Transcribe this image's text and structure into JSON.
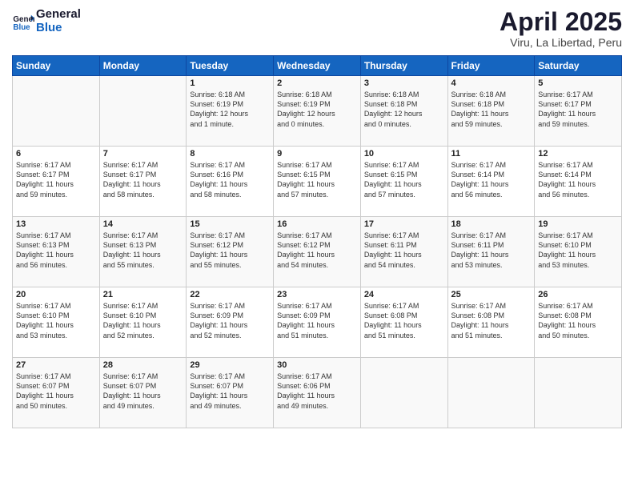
{
  "logo": {
    "line1": "General",
    "line2": "Blue"
  },
  "title": "April 2025",
  "location": "Viru, La Libertad, Peru",
  "weekdays": [
    "Sunday",
    "Monday",
    "Tuesday",
    "Wednesday",
    "Thursday",
    "Friday",
    "Saturday"
  ],
  "weeks": [
    [
      {
        "day": "",
        "info": ""
      },
      {
        "day": "",
        "info": ""
      },
      {
        "day": "1",
        "info": "Sunrise: 6:18 AM\nSunset: 6:19 PM\nDaylight: 12 hours\nand 1 minute."
      },
      {
        "day": "2",
        "info": "Sunrise: 6:18 AM\nSunset: 6:19 PM\nDaylight: 12 hours\nand 0 minutes."
      },
      {
        "day": "3",
        "info": "Sunrise: 6:18 AM\nSunset: 6:18 PM\nDaylight: 12 hours\nand 0 minutes."
      },
      {
        "day": "4",
        "info": "Sunrise: 6:18 AM\nSunset: 6:18 PM\nDaylight: 11 hours\nand 59 minutes."
      },
      {
        "day": "5",
        "info": "Sunrise: 6:17 AM\nSunset: 6:17 PM\nDaylight: 11 hours\nand 59 minutes."
      }
    ],
    [
      {
        "day": "6",
        "info": "Sunrise: 6:17 AM\nSunset: 6:17 PM\nDaylight: 11 hours\nand 59 minutes."
      },
      {
        "day": "7",
        "info": "Sunrise: 6:17 AM\nSunset: 6:17 PM\nDaylight: 11 hours\nand 58 minutes."
      },
      {
        "day": "8",
        "info": "Sunrise: 6:17 AM\nSunset: 6:16 PM\nDaylight: 11 hours\nand 58 minutes."
      },
      {
        "day": "9",
        "info": "Sunrise: 6:17 AM\nSunset: 6:15 PM\nDaylight: 11 hours\nand 57 minutes."
      },
      {
        "day": "10",
        "info": "Sunrise: 6:17 AM\nSunset: 6:15 PM\nDaylight: 11 hours\nand 57 minutes."
      },
      {
        "day": "11",
        "info": "Sunrise: 6:17 AM\nSunset: 6:14 PM\nDaylight: 11 hours\nand 56 minutes."
      },
      {
        "day": "12",
        "info": "Sunrise: 6:17 AM\nSunset: 6:14 PM\nDaylight: 11 hours\nand 56 minutes."
      }
    ],
    [
      {
        "day": "13",
        "info": "Sunrise: 6:17 AM\nSunset: 6:13 PM\nDaylight: 11 hours\nand 56 minutes."
      },
      {
        "day": "14",
        "info": "Sunrise: 6:17 AM\nSunset: 6:13 PM\nDaylight: 11 hours\nand 55 minutes."
      },
      {
        "day": "15",
        "info": "Sunrise: 6:17 AM\nSunset: 6:12 PM\nDaylight: 11 hours\nand 55 minutes."
      },
      {
        "day": "16",
        "info": "Sunrise: 6:17 AM\nSunset: 6:12 PM\nDaylight: 11 hours\nand 54 minutes."
      },
      {
        "day": "17",
        "info": "Sunrise: 6:17 AM\nSunset: 6:11 PM\nDaylight: 11 hours\nand 54 minutes."
      },
      {
        "day": "18",
        "info": "Sunrise: 6:17 AM\nSunset: 6:11 PM\nDaylight: 11 hours\nand 53 minutes."
      },
      {
        "day": "19",
        "info": "Sunrise: 6:17 AM\nSunset: 6:10 PM\nDaylight: 11 hours\nand 53 minutes."
      }
    ],
    [
      {
        "day": "20",
        "info": "Sunrise: 6:17 AM\nSunset: 6:10 PM\nDaylight: 11 hours\nand 53 minutes."
      },
      {
        "day": "21",
        "info": "Sunrise: 6:17 AM\nSunset: 6:10 PM\nDaylight: 11 hours\nand 52 minutes."
      },
      {
        "day": "22",
        "info": "Sunrise: 6:17 AM\nSunset: 6:09 PM\nDaylight: 11 hours\nand 52 minutes."
      },
      {
        "day": "23",
        "info": "Sunrise: 6:17 AM\nSunset: 6:09 PM\nDaylight: 11 hours\nand 51 minutes."
      },
      {
        "day": "24",
        "info": "Sunrise: 6:17 AM\nSunset: 6:08 PM\nDaylight: 11 hours\nand 51 minutes."
      },
      {
        "day": "25",
        "info": "Sunrise: 6:17 AM\nSunset: 6:08 PM\nDaylight: 11 hours\nand 51 minutes."
      },
      {
        "day": "26",
        "info": "Sunrise: 6:17 AM\nSunset: 6:08 PM\nDaylight: 11 hours\nand 50 minutes."
      }
    ],
    [
      {
        "day": "27",
        "info": "Sunrise: 6:17 AM\nSunset: 6:07 PM\nDaylight: 11 hours\nand 50 minutes."
      },
      {
        "day": "28",
        "info": "Sunrise: 6:17 AM\nSunset: 6:07 PM\nDaylight: 11 hours\nand 49 minutes."
      },
      {
        "day": "29",
        "info": "Sunrise: 6:17 AM\nSunset: 6:07 PM\nDaylight: 11 hours\nand 49 minutes."
      },
      {
        "day": "30",
        "info": "Sunrise: 6:17 AM\nSunset: 6:06 PM\nDaylight: 11 hours\nand 49 minutes."
      },
      {
        "day": "",
        "info": ""
      },
      {
        "day": "",
        "info": ""
      },
      {
        "day": "",
        "info": ""
      }
    ]
  ]
}
